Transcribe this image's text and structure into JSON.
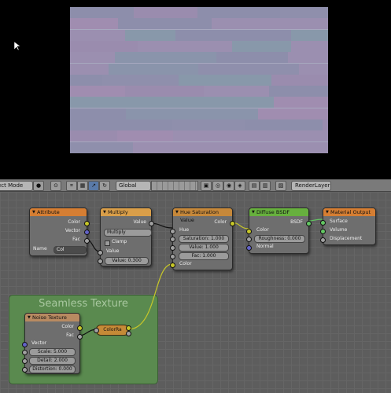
{
  "toolbar": {
    "mode": "ect Mode",
    "transform_space": "Global",
    "render_layer": "RenderLayer"
  },
  "frame": {
    "title": "Seamless Texture"
  },
  "nodes": {
    "attribute": {
      "title": "Attribute",
      "color_label": "Color",
      "vector_label": "Vector",
      "fac_label": "Fac",
      "name_label": "Name",
      "name_value": "Col"
    },
    "multiply": {
      "title": "Multiply",
      "value_label": "Value",
      "blend_mode": "Multiply",
      "clamp_label": "Clamp",
      "input_label": "Value",
      "input_value": "Value: 0.300"
    },
    "hue_sat": {
      "title": "Hue Saturation Value",
      "color_out": "Color",
      "hue": "Hue",
      "saturation": "Saturation: 1.000",
      "value": "Value: 1.000",
      "fac": "Fac: 1.000",
      "color_in": "Color"
    },
    "diffuse": {
      "title": "Diffuse BSDF",
      "bsdf": "BSDF",
      "color": "Color",
      "roughness": "Roughness: 0.000",
      "normal": "Normal"
    },
    "output": {
      "title": "Material Output",
      "surface": "Surface",
      "volume": "Volume",
      "displacement": "Displacement"
    },
    "noise": {
      "title": "Noise Texture",
      "color": "Color",
      "fac": "Fac",
      "vector": "Vector",
      "scale": "Scale: 5.000",
      "detail": "Detail: 2.000",
      "distortion": "Distortion: 0.000"
    },
    "colorramp": {
      "title": "ColorRa"
    }
  },
  "colors": {
    "header_input": "#d57e33",
    "header_converter": "#d99e49",
    "header_color": "#c6883a",
    "header_shader": "#67b03e",
    "header_output": "#d57e33",
    "header_texture": "#b88a61"
  }
}
